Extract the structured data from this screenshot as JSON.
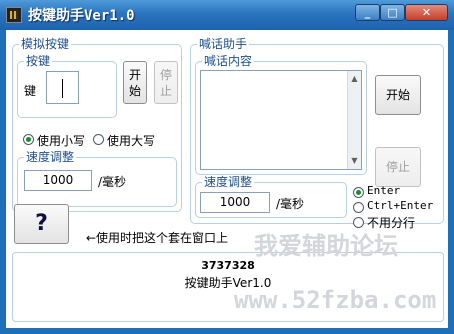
{
  "window": {
    "title": "按键助手Ver1.0"
  },
  "key_group": {
    "title": "模拟按键",
    "sub_title": "按键",
    "key_label": "键",
    "key_value": "",
    "start_label": "开\n始",
    "stop_label": "停\n止",
    "radio_lower": "使用小写",
    "radio_upper": "使用大写",
    "selected_case": "lower",
    "speed_title": "速度调整",
    "speed_value": "1000",
    "speed_unit": "/毫秒"
  },
  "shout_group": {
    "title": "喊话助手",
    "content_title": "喊话内容",
    "content_value": "",
    "start_label": "开始",
    "stop_label": "停止",
    "speed_title": "速度调整",
    "speed_value": "1000",
    "speed_unit": "/毫秒",
    "radio_enter": "Enter",
    "radio_ctrl_enter": "Ctrl+Enter",
    "radio_no_split": "不用分行",
    "selected_newline": "enter"
  },
  "help": {
    "button_label": "?",
    "hint": "←使用时把这个套在窗口上"
  },
  "info": {
    "code": "3737328",
    "name": "按键助手Ver1.0"
  },
  "watermark": {
    "line1": "我爱辅助论坛",
    "line2": "www.52fzba.com"
  },
  "colors": {
    "title_bar": "#2b74bf",
    "group_title": "#1f4f8f",
    "radio_selected": "#1a8c2a"
  }
}
